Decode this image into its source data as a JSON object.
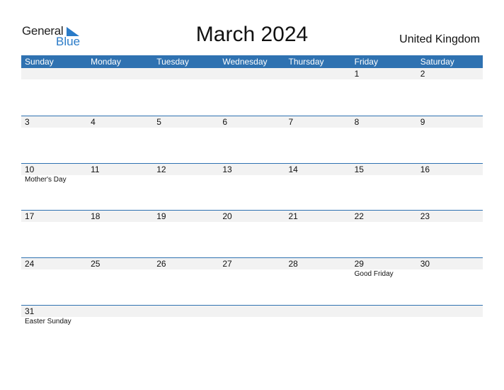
{
  "logo": {
    "word1": "General",
    "word2": "Blue",
    "icon": "triangle-flag-icon"
  },
  "title": "March 2024",
  "country": "United Kingdom",
  "colors": {
    "header_bg": "#2f72b1",
    "strip_bg": "#f2f2f2",
    "logo_blue": "#2a7bc8"
  },
  "weekdays": [
    "Sunday",
    "Monday",
    "Tuesday",
    "Wednesday",
    "Thursday",
    "Friday",
    "Saturday"
  ],
  "weeks": [
    {
      "days": [
        "",
        "",
        "",
        "",
        "",
        "1",
        "2"
      ],
      "events": [
        "",
        "",
        "",
        "",
        "",
        "",
        ""
      ]
    },
    {
      "days": [
        "3",
        "4",
        "5",
        "6",
        "7",
        "8",
        "9"
      ],
      "events": [
        "",
        "",
        "",
        "",
        "",
        "",
        ""
      ]
    },
    {
      "days": [
        "10",
        "11",
        "12",
        "13",
        "14",
        "15",
        "16"
      ],
      "events": [
        "Mother's Day",
        "",
        "",
        "",
        "",
        "",
        ""
      ]
    },
    {
      "days": [
        "17",
        "18",
        "19",
        "20",
        "21",
        "22",
        "23"
      ],
      "events": [
        "",
        "",
        "",
        "",
        "",
        "",
        ""
      ]
    },
    {
      "days": [
        "24",
        "25",
        "26",
        "27",
        "28",
        "29",
        "30"
      ],
      "events": [
        "",
        "",
        "",
        "",
        "",
        "Good Friday",
        ""
      ]
    },
    {
      "days": [
        "31",
        "",
        "",
        "",
        "",
        "",
        ""
      ],
      "events": [
        "Easter Sunday",
        "",
        "",
        "",
        "",
        "",
        ""
      ]
    }
  ]
}
